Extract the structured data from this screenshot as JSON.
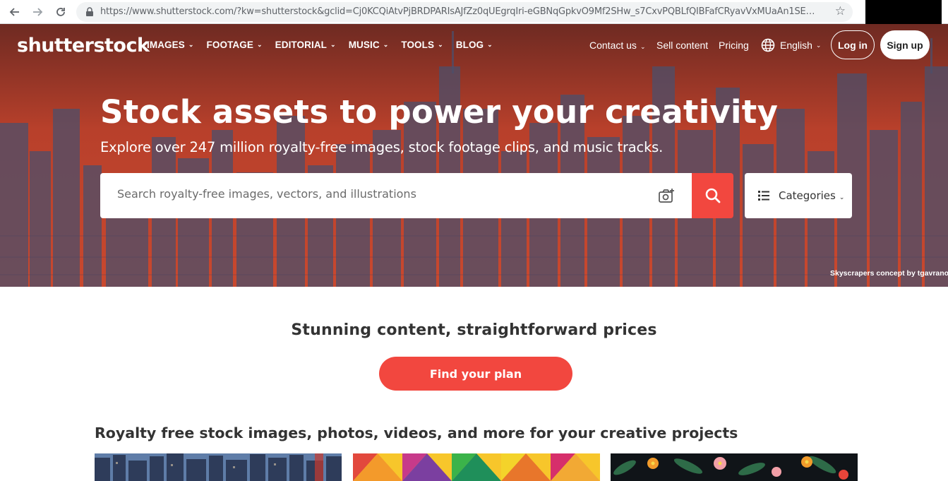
{
  "browser": {
    "url": "https://www.shutterstock.com/?kw=shutterstock&gclid=Cj0KCQiAtvPjBRDPARIsAJfZz0qUEgrqIri-eGBNqGpkvO9Mf2SHw_s7CxvPQBLfQIBFafCRyavVxMUaAn1SEALw_..."
  },
  "header": {
    "logo": "shutterstock",
    "nav": [
      {
        "label": "IMAGES"
      },
      {
        "label": "FOOTAGE"
      },
      {
        "label": "EDITORIAL"
      },
      {
        "label": "MUSIC"
      },
      {
        "label": "TOOLS"
      },
      {
        "label": "BLOG"
      }
    ],
    "contact": "Contact us",
    "sell": "Sell content",
    "pricing": "Pricing",
    "language": "English",
    "login": "Log in",
    "signup": "Sign up"
  },
  "hero": {
    "title": "Stock assets to power your creativity",
    "subtitle": "Explore over 247 million royalty-free images, stock footage clips, and music tracks.",
    "search_placeholder": "Search royalty-free images, vectors, and illustrations",
    "categories_label": "Categories",
    "credit": "Skyscrapers concept by tgavrano"
  },
  "promo": {
    "title": "Stunning content, straightforward prices",
    "button": "Find your plan"
  },
  "section": {
    "title": "Royalty free stock images, photos, videos, and more for your creative projects"
  },
  "colors": {
    "accent": "#f2473f"
  }
}
